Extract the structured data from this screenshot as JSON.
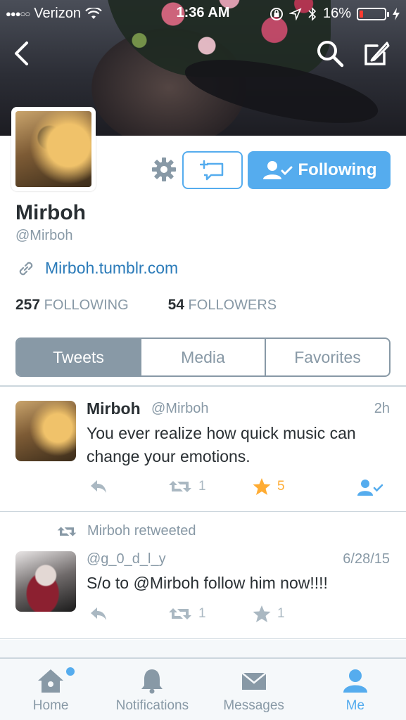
{
  "status_bar": {
    "carrier": "Verizon",
    "time": "1:36 AM",
    "battery": "16%",
    "battery_level": 0.16
  },
  "profile": {
    "name": "Mirboh",
    "handle": "@Mirboh",
    "url": "Mirboh.tumblr.com",
    "following_count": "257",
    "following_label": "FOLLOWING",
    "followers_count": "54",
    "followers_label": "FOLLOWERS",
    "follow_button_label": "Following"
  },
  "segments": [
    "Tweets",
    "Media",
    "Favorites"
  ],
  "active_segment": "Tweets",
  "tweets": [
    {
      "name": "Mirboh",
      "handle": "@Mirboh",
      "time": "2h",
      "text": "You ever realize how quick music can change your emotions.",
      "retweets": "1",
      "favorites": "5",
      "favorited": true
    },
    {
      "retweeted_by": "Mirboh retweeted",
      "handle": "@g_0_d_l_y",
      "time": "6/28/15",
      "text": "S/o to @Mirboh follow him now!!!!",
      "retweets": "1",
      "favorites": "1",
      "favorited": false
    }
  ],
  "tabbar": [
    {
      "label": "Home",
      "icon": "home-icon"
    },
    {
      "label": "Notifications",
      "icon": "bell-icon"
    },
    {
      "label": "Messages",
      "icon": "envelope-icon"
    },
    {
      "label": "Me",
      "icon": "person-icon"
    }
  ],
  "colors": {
    "accent": "#55acee",
    "muted": "#8899a6",
    "star": "#ffac33",
    "link": "#2b7bb9"
  }
}
